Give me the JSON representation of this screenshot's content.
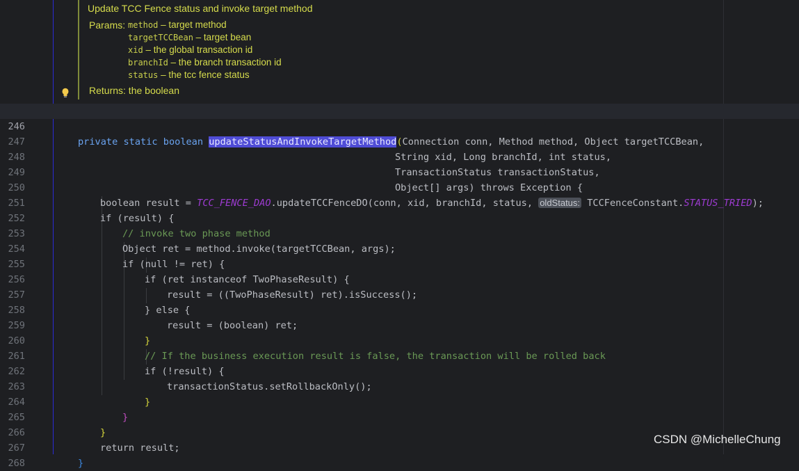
{
  "doc": {
    "title": "Update TCC Fence status and invoke target method",
    "params_label": "Params:",
    "params": [
      {
        "name": "method",
        "desc": " – target method"
      },
      {
        "name": "targetTCCBean",
        "desc": " – target bean"
      },
      {
        "name": "xid",
        "desc": " – the global transaction id"
      },
      {
        "name": "branchId",
        "desc": " – the branch transaction id"
      },
      {
        "name": "status",
        "desc": " – the tcc fence status"
      }
    ],
    "returns_label": "Returns:",
    "returns_text": " the boolean"
  },
  "lines": {
    "l246": "246",
    "l247": "247",
    "l248": "248",
    "l249": "249",
    "l250": "250",
    "l251": "251",
    "l252": "252",
    "l253": "253",
    "l254": "254",
    "l255": "255",
    "l256": "256",
    "l257": "257",
    "l258": "258",
    "l259": "259",
    "l260": "260",
    "l261": "261",
    "l262": "262",
    "l263": "263",
    "l264": "264",
    "l265": "265",
    "l266": "266",
    "l267": "267",
    "l268": "268"
  },
  "code": {
    "private_static_boolean": "private static boolean ",
    "method_name": "updateStatusAndInvokeTargetMethod",
    "sig_params_1": "Connection conn, Method method, Object targetTCCBean,",
    "sig_params_2": "String xid, Long branchId, int status,",
    "sig_params_3": "TransactionStatus transactionStatus,",
    "sig_params_4": "Object[] args) throws Exception {",
    "l250_prefix": "boolean result = ",
    "l250_dao": "TCC_FENCE_DAO",
    "l250_call": ".updateTCCFenceDO(conn, xid, branchId, status, ",
    "l250_hint": "oldStatus:",
    "l250_const_cls": " TCCFenceConstant.",
    "l250_const": "STATUS_TRIED",
    "l250_end": ");",
    "l251": "if (result) {",
    "l252_comment": "// invoke two phase method",
    "l253": "Object ret = method.invoke(targetTCCBean, args);",
    "l254": "if (null != ret) {",
    "l255": "if (ret instanceof TwoPhaseResult) {",
    "l256": "result = ((TwoPhaseResult) ret).isSuccess();",
    "l257": "} else {",
    "l258": "result = (boolean) ret;",
    "l259": "}",
    "l260_comment": "// If the business execution result is false, the transaction will be rolled back",
    "l261": "if (!result) {",
    "l262": "transactionStatus.setRollbackOnly();",
    "l263": "}",
    "l264": "}",
    "l265": "}",
    "l266": "return result;",
    "l267": "}"
  },
  "watermark": "CSDN @MichelleChung",
  "icons": {
    "bulb": "lightbulb-icon"
  }
}
